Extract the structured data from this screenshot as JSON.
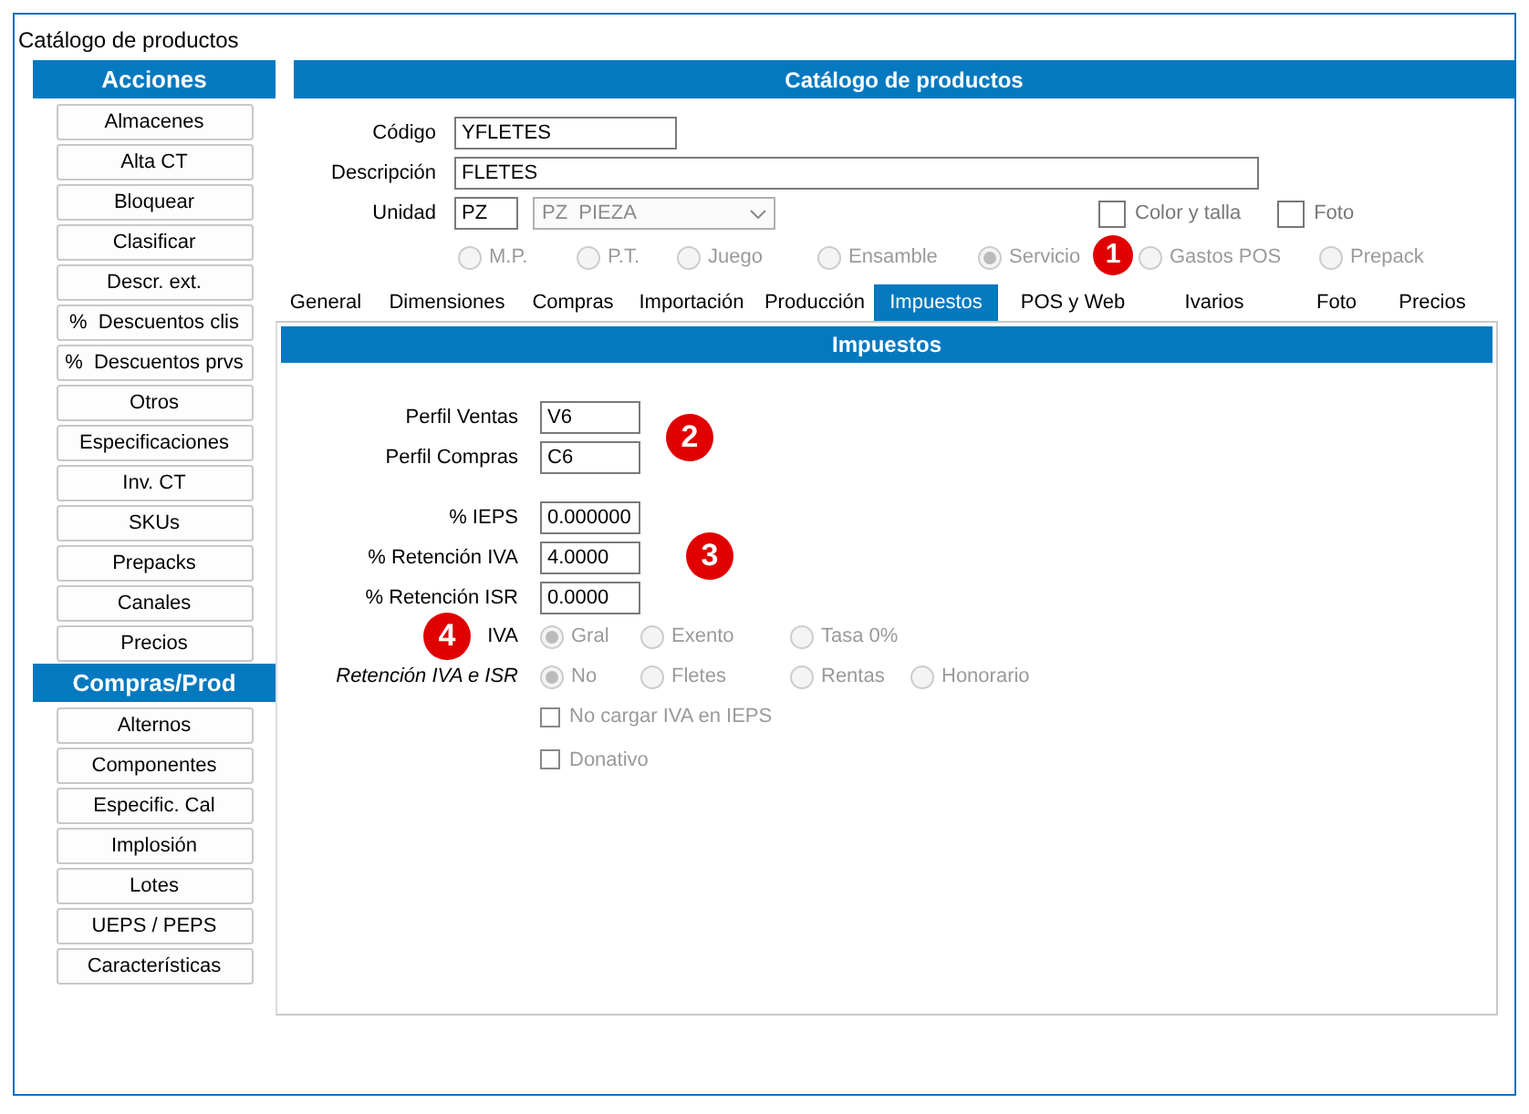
{
  "window": {
    "title": "Catálogo de productos"
  },
  "sidebar": {
    "sections": [
      {
        "title": "Acciones",
        "items": [
          "Almacenes",
          "Alta CT",
          "Bloquear",
          "Clasificar",
          "Descr. ext.",
          "%  Descuentos clis",
          "%  Descuentos prvs",
          "Otros",
          "Especificaciones",
          "Inv. CT",
          "SKUs",
          "Prepacks",
          "Canales",
          "Precios"
        ]
      },
      {
        "title": "Compras/Prod",
        "items": [
          "Alternos",
          "Componentes",
          "Especific. Cal",
          "Implosión",
          "Lotes",
          "UEPS / PEPS",
          "Características"
        ]
      }
    ]
  },
  "header": "Catálogo de productos",
  "form": {
    "fields": [
      {
        "label": "Código",
        "value": "YFLETES"
      },
      {
        "label": "Descripción",
        "value": "FLETES"
      }
    ],
    "unit": {
      "label": "Unidad",
      "code": "PZ",
      "select": "PZ  PIEZA"
    },
    "checkboxes": [
      {
        "label": "Color y talla",
        "checked": false
      },
      {
        "label": "Foto",
        "checked": false
      }
    ],
    "types": {
      "disabled": true,
      "options": [
        {
          "label": "M.P.",
          "selected": false
        },
        {
          "label": "P.T.",
          "selected": false
        },
        {
          "label": "Juego",
          "selected": false
        },
        {
          "label": "Ensamble",
          "selected": false
        },
        {
          "label": "Servicio",
          "selected": true
        },
        {
          "label": "Gastos POS",
          "selected": false
        },
        {
          "label": "Prepack",
          "selected": false
        }
      ]
    }
  },
  "tabs": [
    {
      "label": "General",
      "selected": false
    },
    {
      "label": "Dimensiones",
      "selected": false
    },
    {
      "label": "Compras",
      "selected": false
    },
    {
      "label": "Importación",
      "selected": false
    },
    {
      "label": "Producción",
      "selected": false
    },
    {
      "label": "Impuestos",
      "selected": true
    },
    {
      "label": "POS y Web",
      "selected": false
    },
    {
      "label": "Ivarios",
      "selected": false
    },
    {
      "label": "Foto",
      "selected": false
    },
    {
      "label": "Precios",
      "selected": false
    }
  ],
  "panel": {
    "title": "Impuestos",
    "profiles": [
      {
        "label": "Perfil Ventas",
        "value": "V6"
      },
      {
        "label": "Perfil Compras",
        "value": "C6"
      }
    ],
    "rates": [
      {
        "label": "% IEPS",
        "value": "0.000000"
      },
      {
        "label": "% Retención IVA",
        "value": "4.0000"
      },
      {
        "label": "% Retención ISR",
        "value": "0.0000"
      }
    ],
    "option_groups": [
      {
        "label": "IVA",
        "italic": false,
        "disabled": true,
        "options": [
          {
            "label": "Gral",
            "selected": true
          },
          {
            "label": "Exento",
            "selected": false
          },
          {
            "label": "Tasa 0%",
            "selected": false
          }
        ]
      },
      {
        "label": "Retención IVA e ISR",
        "italic": true,
        "disabled": true,
        "options": [
          {
            "label": "No",
            "selected": true
          },
          {
            "label": "Fletes",
            "selected": false
          },
          {
            "label": "Rentas",
            "selected": false
          },
          {
            "label": "Honorario",
            "selected": false
          }
        ]
      }
    ],
    "checkboxes": [
      {
        "label": "No cargar IVA en IEPS",
        "checked": false,
        "disabled": true
      },
      {
        "label": "Donativo",
        "checked": false,
        "disabled": true
      }
    ]
  },
  "badges": [
    "1",
    "2",
    "3",
    "4"
  ]
}
